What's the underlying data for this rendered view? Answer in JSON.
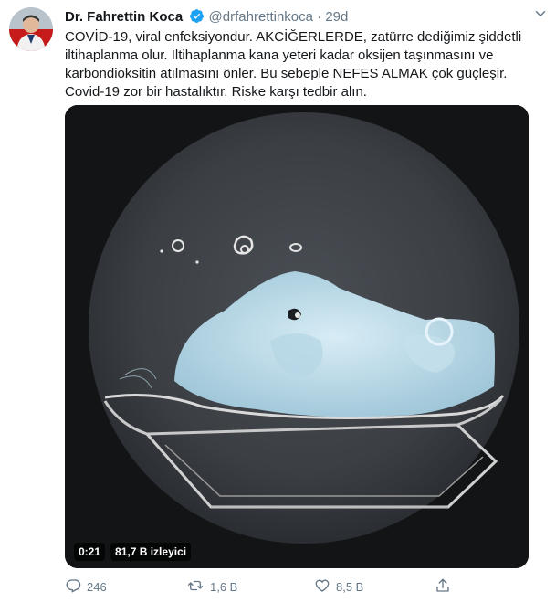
{
  "tweet": {
    "author_name": "Dr. Fahrettin Koca",
    "handle": "@drfahrettinkoca",
    "separator": "·",
    "time": "29d",
    "text": "COVİD-19, viral enfeksiyondur. AKCİĞERLERDE, zatürre dediğimiz şiddetli iltihaplanma olur. İltihaplanma kana yeteri kadar oksijen taşınmasını ve karbondioksitin atılmasını önler. Bu sebeple NEFES ALMAK çok güçleşir. Covid-19 zor bir hastalıktır. Riske karşı tedbir alın."
  },
  "video": {
    "duration": "0:21",
    "views": "81,7 B izleyici"
  },
  "actions": {
    "reply_count": "246",
    "retweet_count": "1,6 B",
    "like_count": "8,5 B"
  },
  "icons": {
    "verified": "verified-badge-icon",
    "more": "chevron-down-icon",
    "reply": "reply-icon",
    "retweet": "retweet-icon",
    "like": "heart-icon",
    "share": "share-icon"
  },
  "colors": {
    "accent": "#1da1f2",
    "secondary_text": "#657786",
    "text": "#14171a"
  }
}
